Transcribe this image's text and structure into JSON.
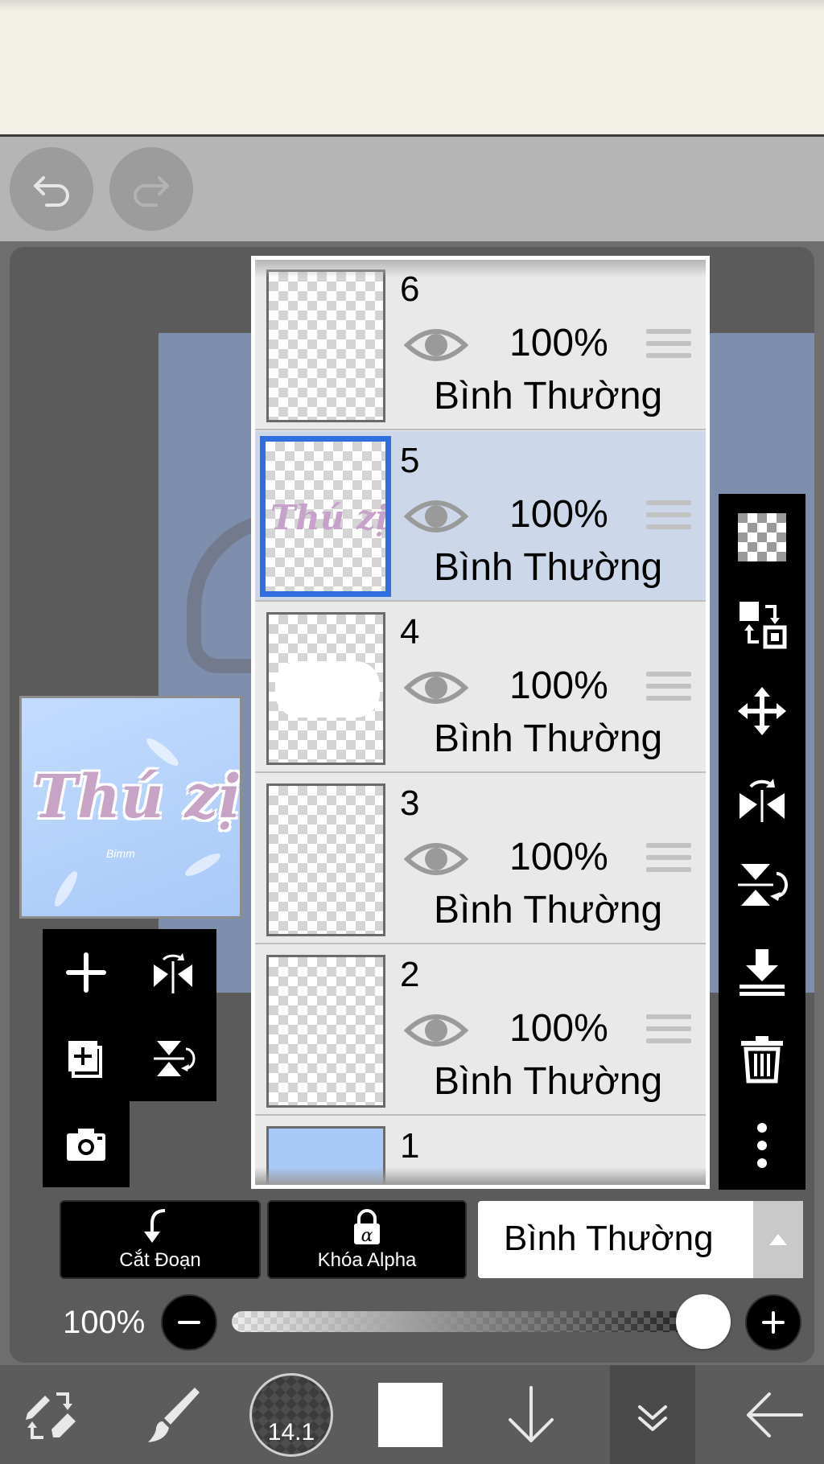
{
  "toolbar": {
    "undo_icon": "undo-icon",
    "redo_icon": "redo-icon"
  },
  "preview": {
    "title": "Thú zị",
    "signature": "Bimm"
  },
  "layers": [
    {
      "number": "6",
      "opacity": "100%",
      "blend": "Bình Thường",
      "selected": false,
      "thumb": "empty"
    },
    {
      "number": "5",
      "opacity": "100%",
      "blend": "Bình Thường",
      "selected": true,
      "thumb": "text",
      "thumb_text": "Thú zị"
    },
    {
      "number": "4",
      "opacity": "100%",
      "blend": "Bình Thường",
      "selected": false,
      "thumb": "blob"
    },
    {
      "number": "3",
      "opacity": "100%",
      "blend": "Bình Thường",
      "selected": false,
      "thumb": "empty"
    },
    {
      "number": "2",
      "opacity": "100%",
      "blend": "Bình Thường",
      "selected": false,
      "thumb": "empty"
    },
    {
      "number": "1",
      "opacity": "",
      "blend": "",
      "selected": false,
      "thumb": "fill"
    }
  ],
  "controls": {
    "clip_label": "Cắt Đoạn",
    "alpha_lock_label": "Khóa Alpha",
    "blend_mode_value": "Bình Thường",
    "opacity_label": "100%",
    "opacity_fraction": 1.0
  },
  "bottom_nav": {
    "brush_size": "14.1"
  },
  "colors": {
    "selected_layer_bg": "#ccd8ea",
    "selected_border": "#2f6fe0",
    "preview_bg": "#a9c9f8",
    "thumb_text": "#c6a1c9"
  }
}
